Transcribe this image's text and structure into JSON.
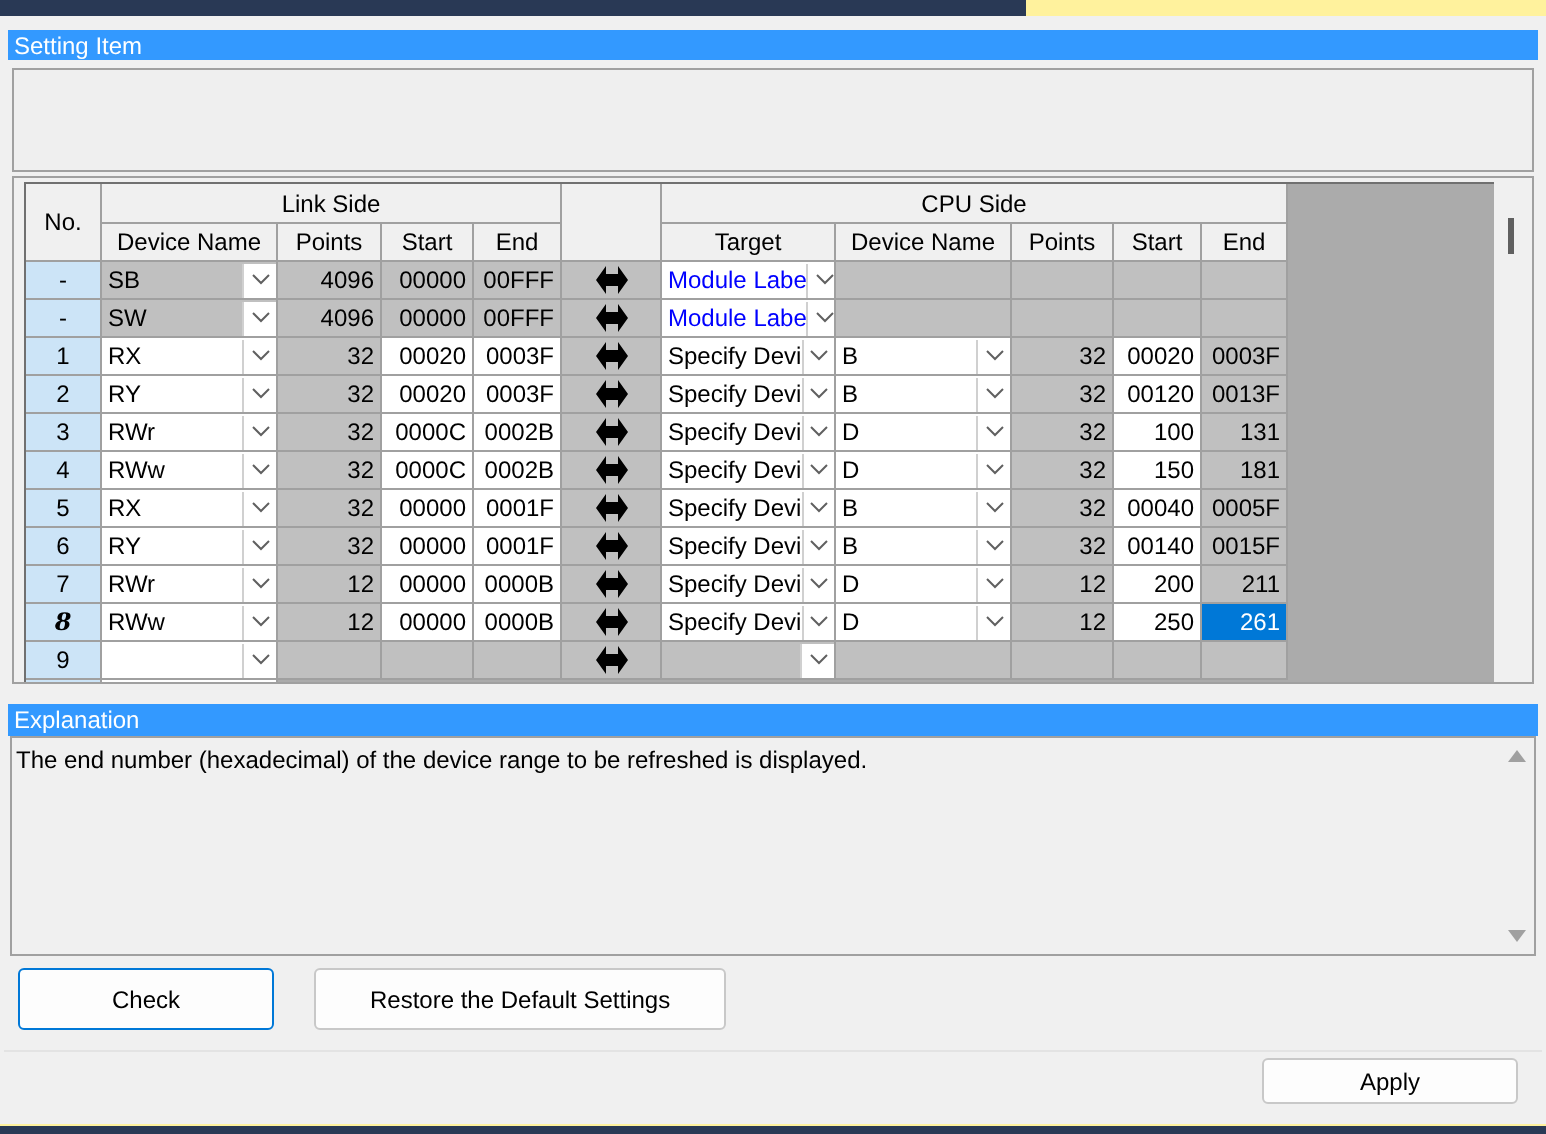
{
  "setting_item": {
    "title": "Setting Item"
  },
  "table": {
    "group_headers": [
      "Link Side",
      "CPU Side"
    ],
    "no_header": "No.",
    "link_columns": [
      "Device Name",
      "Points",
      "Start",
      "End"
    ],
    "cpu_columns": [
      "Target",
      "Device Name",
      "Points",
      "Start",
      "End"
    ],
    "rows": [
      {
        "no": "-",
        "current": false,
        "editable": false,
        "link_device": "SB",
        "link_points": "4096",
        "link_start": "00000",
        "link_end": "00FFF",
        "target": "Module Labe",
        "kind": "label",
        "end_selected": false
      },
      {
        "no": "-",
        "current": false,
        "editable": false,
        "link_device": "SW",
        "link_points": "4096",
        "link_start": "00000",
        "link_end": "00FFF",
        "target": "Module Labe",
        "kind": "label",
        "end_selected": false
      },
      {
        "no": "1",
        "current": false,
        "editable": true,
        "link_device": "RX",
        "link_points": "32",
        "link_start": "00020",
        "link_end": "0003F",
        "target": "Specify Devi",
        "kind": "device",
        "cpu_device": "B",
        "cpu_points": "32",
        "cpu_start": "00020",
        "cpu_end": "0003F",
        "end_selected": false
      },
      {
        "no": "2",
        "current": false,
        "editable": true,
        "link_device": "RY",
        "link_points": "32",
        "link_start": "00020",
        "link_end": "0003F",
        "target": "Specify Devi",
        "kind": "device",
        "cpu_device": "B",
        "cpu_points": "32",
        "cpu_start": "00120",
        "cpu_end": "0013F",
        "end_selected": false
      },
      {
        "no": "3",
        "current": false,
        "editable": true,
        "link_device": "RWr",
        "link_points": "32",
        "link_start": "0000C",
        "link_end": "0002B",
        "target": "Specify Devi",
        "kind": "device",
        "cpu_device": "D",
        "cpu_points": "32",
        "cpu_start": "100",
        "cpu_end": "131",
        "end_selected": false
      },
      {
        "no": "4",
        "current": false,
        "editable": true,
        "link_device": "RWw",
        "link_points": "32",
        "link_start": "0000C",
        "link_end": "0002B",
        "target": "Specify Devi",
        "kind": "device",
        "cpu_device": "D",
        "cpu_points": "32",
        "cpu_start": "150",
        "cpu_end": "181",
        "end_selected": false
      },
      {
        "no": "5",
        "current": false,
        "editable": true,
        "link_device": "RX",
        "link_points": "32",
        "link_start": "00000",
        "link_end": "0001F",
        "target": "Specify Devi",
        "kind": "device",
        "cpu_device": "B",
        "cpu_points": "32",
        "cpu_start": "00040",
        "cpu_end": "0005F",
        "end_selected": false
      },
      {
        "no": "6",
        "current": false,
        "editable": true,
        "link_device": "RY",
        "link_points": "32",
        "link_start": "00000",
        "link_end": "0001F",
        "target": "Specify Devi",
        "kind": "device",
        "cpu_device": "B",
        "cpu_points": "32",
        "cpu_start": "00140",
        "cpu_end": "0015F",
        "end_selected": false
      },
      {
        "no": "7",
        "current": false,
        "editable": true,
        "link_device": "RWr",
        "link_points": "12",
        "link_start": "00000",
        "link_end": "0000B",
        "target": "Specify Devi",
        "kind": "device",
        "cpu_device": "D",
        "cpu_points": "12",
        "cpu_start": "200",
        "cpu_end": "211",
        "end_selected": false
      },
      {
        "no": "8",
        "current": true,
        "editable": true,
        "link_device": "RWw",
        "link_points": "12",
        "link_start": "00000",
        "link_end": "0000B",
        "target": "Specify Devi",
        "kind": "device",
        "cpu_device": "D",
        "cpu_points": "12",
        "cpu_start": "250",
        "cpu_end": "261",
        "end_selected": true
      },
      {
        "no": "9",
        "current": false,
        "editable": false,
        "kind": "blank",
        "end_selected": false
      }
    ]
  },
  "explanation": {
    "title": "Explanation",
    "text": "The end number (hexadecimal) of the device range to be refreshed is displayed."
  },
  "buttons": [
    {
      "label": "Check",
      "focused": true
    },
    {
      "label": "Restore the Default Settings",
      "focused": false
    }
  ],
  "apply_button": {
    "label": "Apply"
  }
}
